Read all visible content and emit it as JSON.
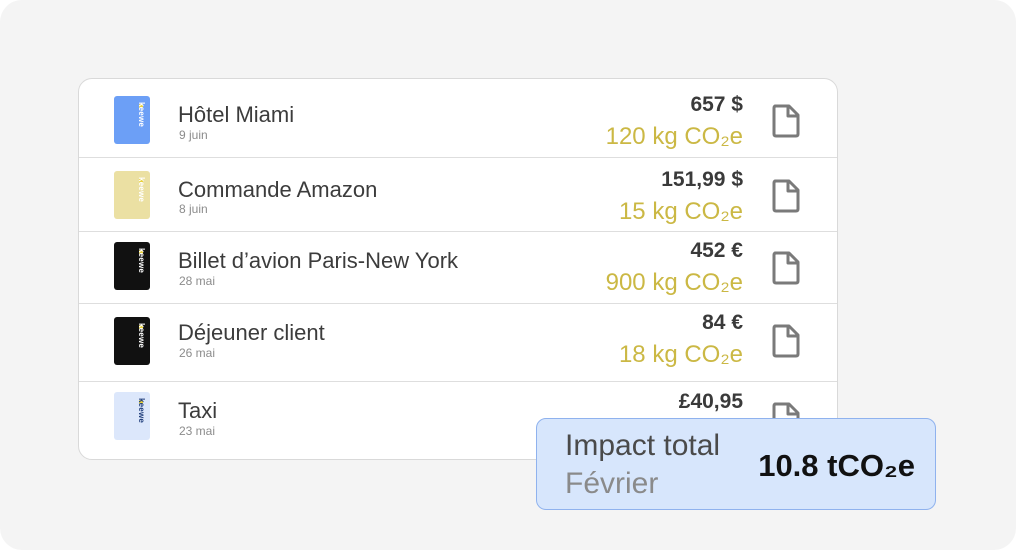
{
  "colors": {
    "background": "#f4f4f4",
    "co2_accent": "#cbb844",
    "impact_bg": "#d7e6fc",
    "impact_border": "#8fb2ee"
  },
  "transactions": [
    {
      "title": "Hôtel Miami",
      "date": "9 juin",
      "amount": "657 $",
      "co2": "120 kg CO₂e",
      "card_color": "#6c9ff6",
      "card_brand": "keewe",
      "card_text_color": "#ffffff",
      "icon": "document-icon"
    },
    {
      "title": "Commande Amazon",
      "date": "8 juin",
      "amount": "151,99 $",
      "co2": "15 kg CO₂e",
      "card_color": "#ebe0a3",
      "card_brand": "keewe",
      "card_text_color": "#ffffff",
      "icon": "document-icon"
    },
    {
      "title": "Billet d’avion Paris-New York",
      "date": "28 mai",
      "amount": "452 €",
      "co2": "900 kg CO₂e",
      "card_color": "#111111",
      "card_brand": "keewe",
      "card_text_color": "#ffffff",
      "icon": "document-icon"
    },
    {
      "title": "Déjeuner client",
      "date": "26 mai",
      "amount": "84 €",
      "co2": "18 kg CO₂e",
      "card_color": "#111111",
      "card_brand": "keewe",
      "card_text_color": "#ffffff",
      "icon": "document-icon"
    },
    {
      "title": "Taxi",
      "date": "23 mai",
      "amount": "£40,95",
      "co2": "",
      "card_color": "#dce7fb",
      "card_brand": "keewe",
      "card_text_color": "#1f3d7a",
      "icon": "document-icon"
    }
  ],
  "impact": {
    "title": "Impact total",
    "period": "Février",
    "value": "10.8 tCO₂e"
  }
}
